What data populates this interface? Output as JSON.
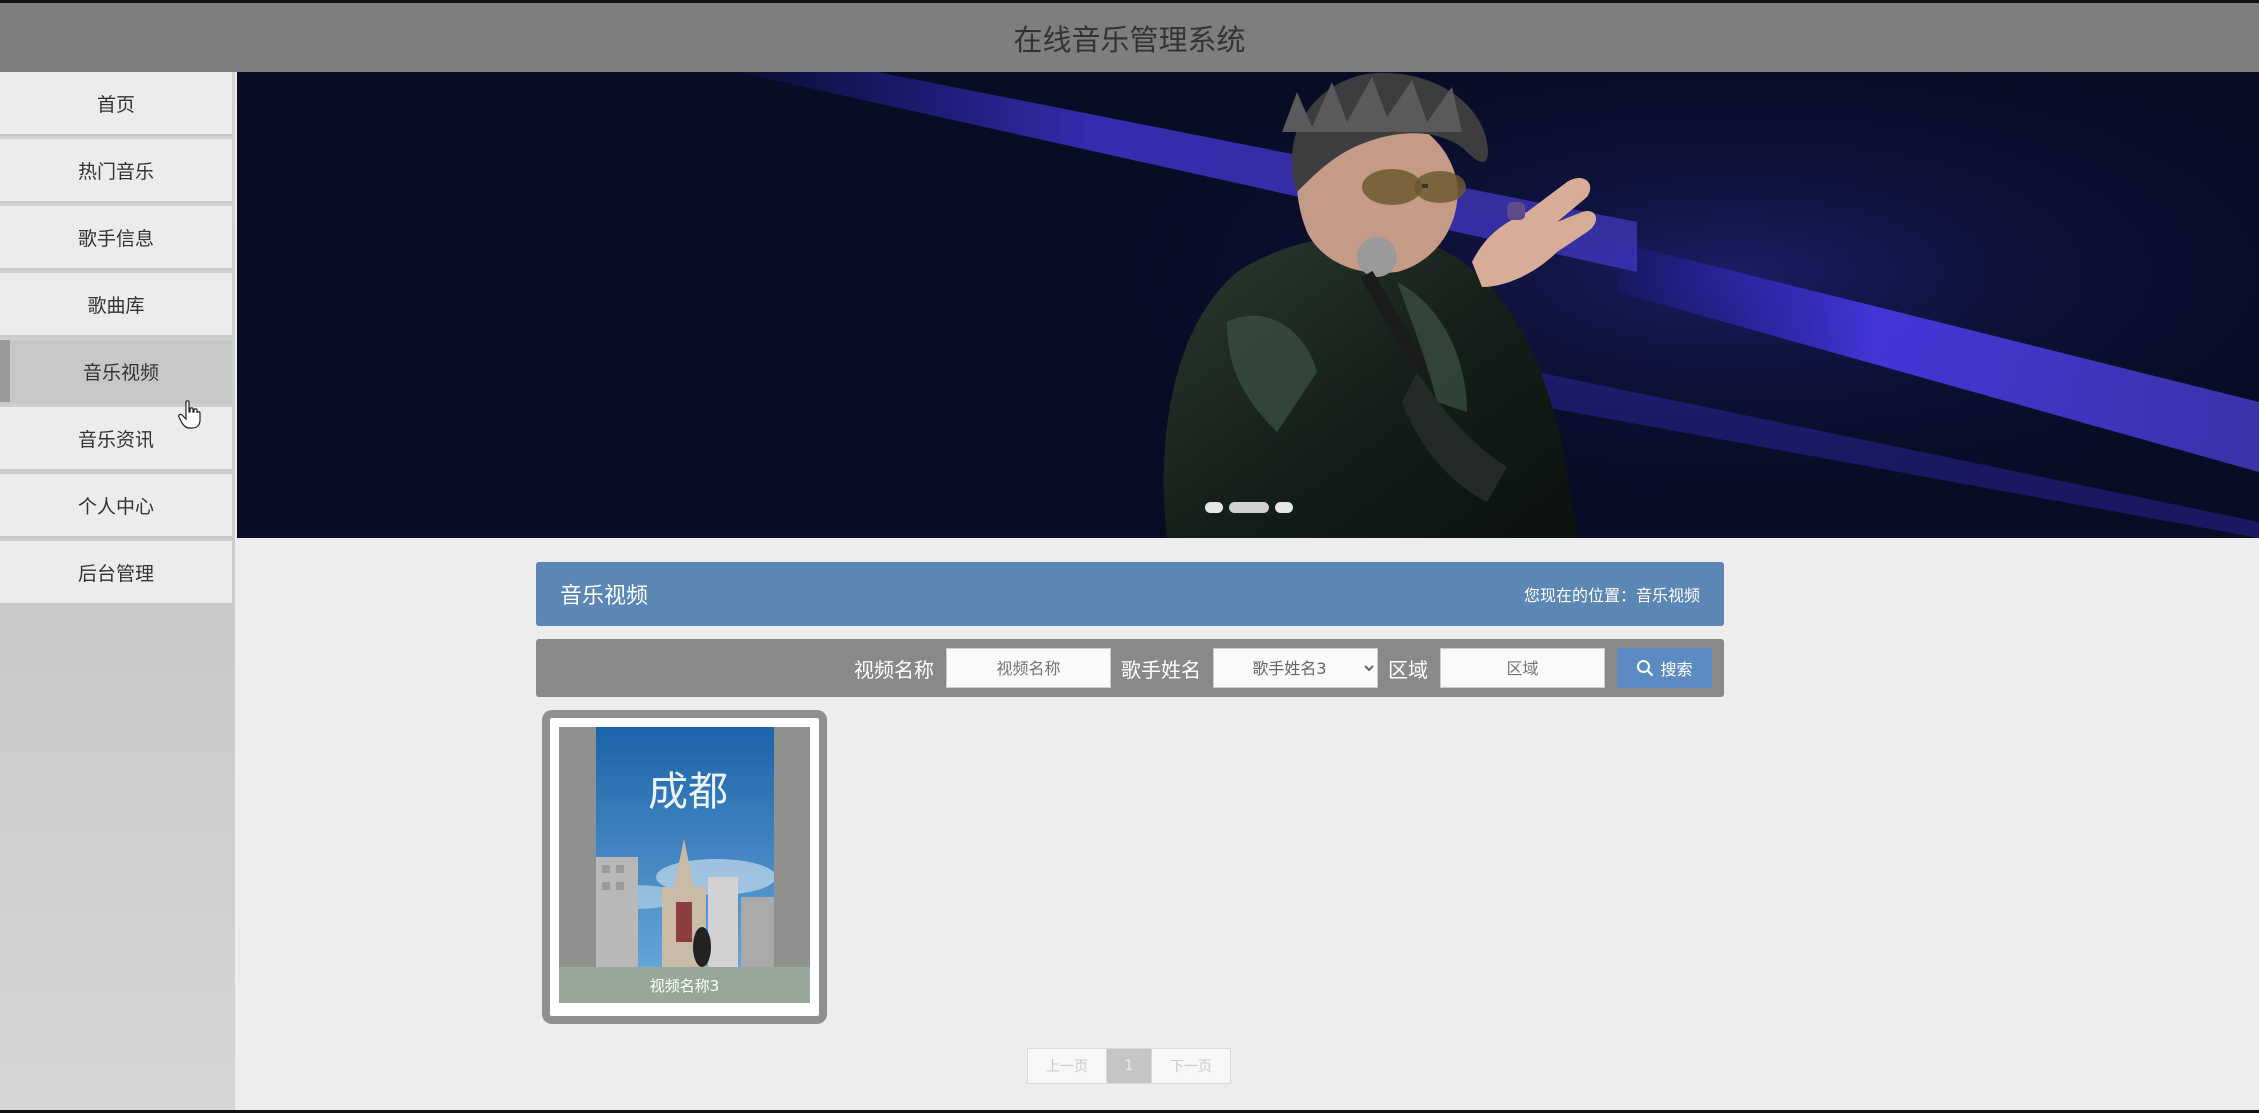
{
  "header": {
    "title": "在线音乐管理系统"
  },
  "sidebar": {
    "items": [
      {
        "label": "首页",
        "active": false
      },
      {
        "label": "热门音乐",
        "active": false
      },
      {
        "label": "歌手信息",
        "active": false
      },
      {
        "label": "歌曲库",
        "active": false
      },
      {
        "label": "音乐视频",
        "active": true
      },
      {
        "label": "音乐资讯",
        "active": false
      },
      {
        "label": "个人中心",
        "active": false
      },
      {
        "label": "后台管理",
        "active": false
      }
    ]
  },
  "section": {
    "title": "音乐视频",
    "breadcrumb": "您现在的位置：音乐视频"
  },
  "search": {
    "video_label": "视频名称",
    "video_placeholder": "视频名称",
    "singer_label": "歌手姓名",
    "singer_selected": "歌手姓名3",
    "region_label": "区域",
    "region_placeholder": "区域",
    "button_label": "搜索"
  },
  "videos": [
    {
      "name": "视频名称3",
      "poster_text": "成都"
    }
  ],
  "pagination": {
    "prev": "上一页",
    "current": "1",
    "next": "下一页"
  }
}
